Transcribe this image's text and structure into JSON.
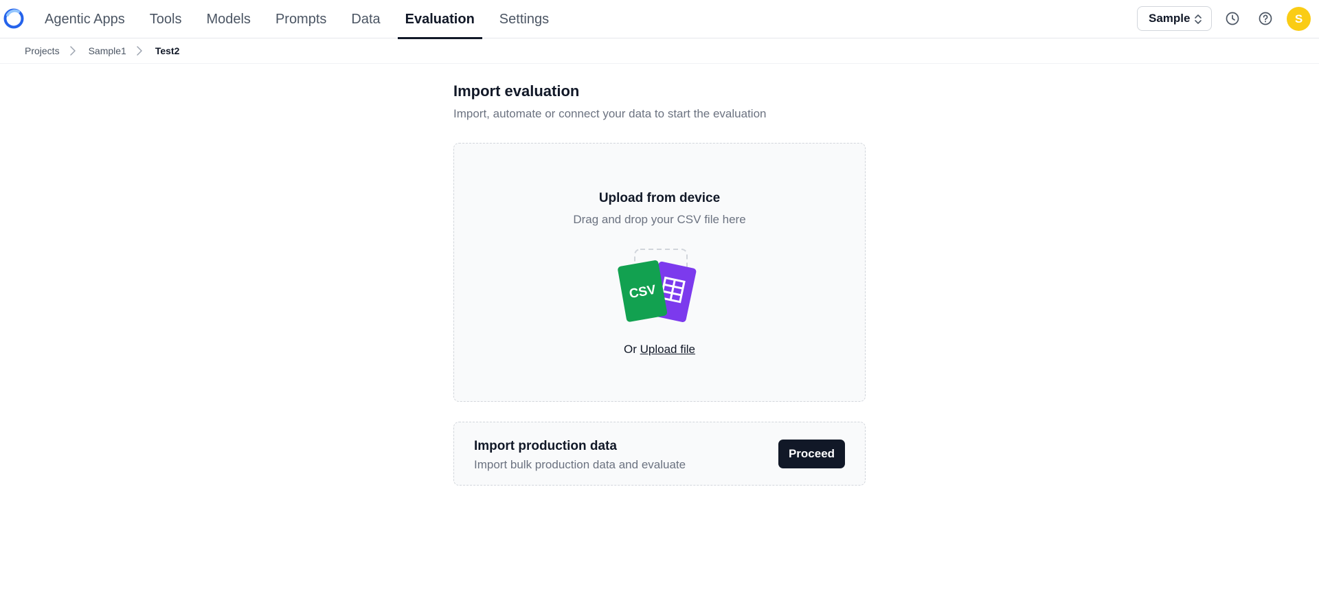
{
  "nav": {
    "logo_icon": "app-logo-ring",
    "tabs": [
      {
        "label": "Agentic Apps",
        "active": false
      },
      {
        "label": "Tools",
        "active": false
      },
      {
        "label": "Models",
        "active": false
      },
      {
        "label": "Prompts",
        "active": false
      },
      {
        "label": "Data",
        "active": false
      },
      {
        "label": "Evaluation",
        "active": true
      },
      {
        "label": "Settings",
        "active": false
      }
    ],
    "workspace": "Sample",
    "history_icon": "clock-icon",
    "help_icon": "help-circle-icon",
    "avatar_initial": "S",
    "avatar_color": "#facc15"
  },
  "breadcrumb": {
    "items": [
      "Projects",
      "Sample1",
      "Test2"
    ]
  },
  "main": {
    "title": "Import evaluation",
    "subtitle": "Import, automate or connect your data to start the evaluation",
    "upload": {
      "title": "Upload from device",
      "subtitle": "Drag and drop your CSV file here",
      "csv_badge": "CSV",
      "or_text": "Or",
      "link_text": "Upload file"
    },
    "production": {
      "title": "Import production data",
      "subtitle": "Import bulk production data and evaluate",
      "button": "Proceed"
    }
  },
  "colors": {
    "csv_green": "#12a150",
    "sheet_purple": "#7c3aed",
    "primary_dark": "#111827"
  }
}
